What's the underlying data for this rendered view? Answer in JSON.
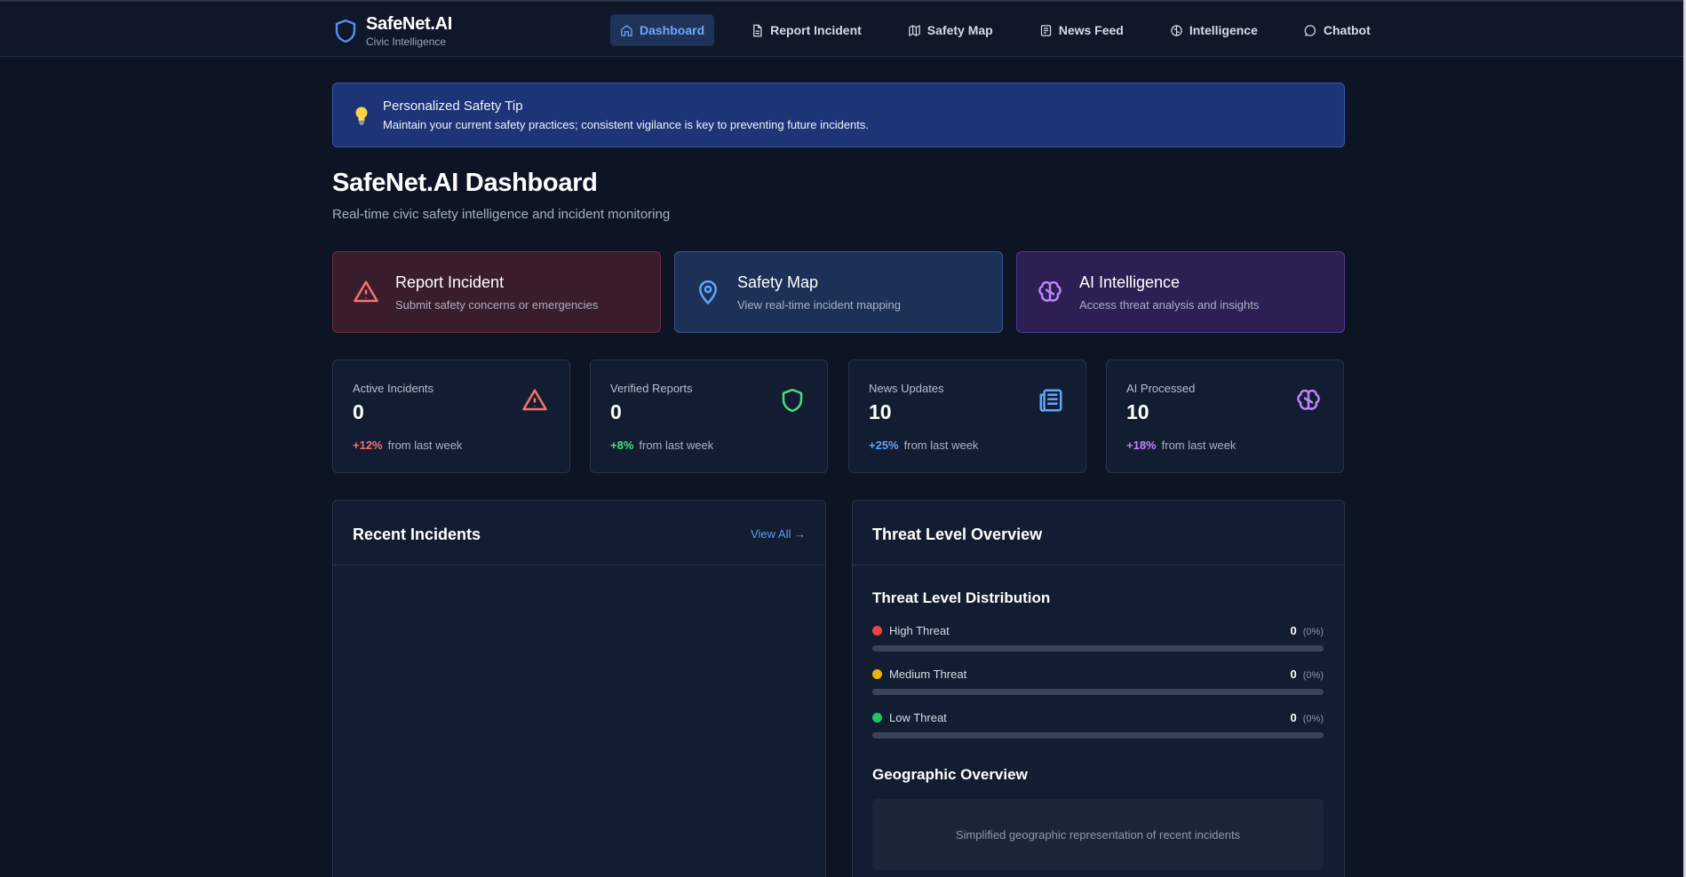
{
  "brand": {
    "name": "SafeNet.AI",
    "subtitle": "Civic Intelligence"
  },
  "nav": [
    {
      "label": "Dashboard",
      "icon": "home-icon",
      "active": true
    },
    {
      "label": "Report Incident",
      "icon": "document-icon"
    },
    {
      "label": "Safety Map",
      "icon": "map-icon"
    },
    {
      "label": "News Feed",
      "icon": "newspaper-icon"
    },
    {
      "label": "Intelligence",
      "icon": "brain-icon"
    },
    {
      "label": "Chatbot",
      "icon": "chat-icon"
    }
  ],
  "tip": {
    "title": "Personalized Safety Tip",
    "text": "Maintain your current safety practices; consistent vigilance is key to preventing future incidents.",
    "icon": "lightbulb-icon"
  },
  "page": {
    "title": "SafeNet.AI Dashboard",
    "subtitle": "Real-time civic safety intelligence and incident monitoring"
  },
  "actions": [
    {
      "title": "Report Incident",
      "subtitle": "Submit safety concerns or emergencies",
      "icon": "alert-triangle-icon",
      "color": "#f87171"
    },
    {
      "title": "Safety Map",
      "subtitle": "View real-time incident mapping",
      "icon": "map-pin-icon",
      "color": "#60a5fa"
    },
    {
      "title": "AI Intelligence",
      "subtitle": "Access threat analysis and insights",
      "icon": "brain-icon",
      "color": "#c084fc"
    }
  ],
  "stats": [
    {
      "label": "Active Incidents",
      "value": "0",
      "change": "+12%",
      "change_text": "from last week",
      "color": "#f87171",
      "icon": "alert-triangle-icon"
    },
    {
      "label": "Verified Reports",
      "value": "0",
      "change": "+8%",
      "change_text": "from last week",
      "color": "#4ade80",
      "icon": "shield-icon"
    },
    {
      "label": "News Updates",
      "value": "10",
      "change": "+25%",
      "change_text": "from last week",
      "color": "#60a5fa",
      "icon": "newspaper-icon"
    },
    {
      "label": "AI Processed",
      "value": "10",
      "change": "+18%",
      "change_text": "from last week",
      "color": "#c084fc",
      "icon": "brain-icon"
    }
  ],
  "recent_incidents": {
    "title": "Recent Incidents",
    "view_all": "View All →"
  },
  "threat_overview": {
    "title": "Threat Level Overview",
    "distribution_title": "Threat Level Distribution",
    "levels": [
      {
        "label": "High Threat",
        "count": "0",
        "percent": "(0%)",
        "color": "#ef4444",
        "fraction": 0
      },
      {
        "label": "Medium Threat",
        "count": "0",
        "percent": "(0%)",
        "color": "#eab308",
        "fraction": 0
      },
      {
        "label": "Low Threat",
        "count": "0",
        "percent": "(0%)",
        "color": "#22c55e",
        "fraction": 0
      }
    ],
    "geo_title": "Geographic Overview",
    "geo_text": "Simplified geographic representation of recent incidents"
  }
}
